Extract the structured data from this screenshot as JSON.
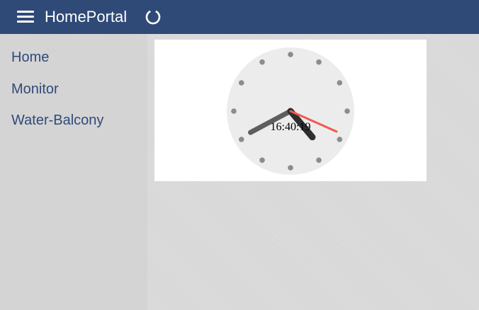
{
  "header": {
    "title": "HomePortal",
    "menu_icon": "hamburger-menu-icon",
    "refresh_icon": "refresh-icon",
    "background_color": "#304a78"
  },
  "sidebar": {
    "items": [
      {
        "label": "Home"
      },
      {
        "label": "Monitor"
      },
      {
        "label": "Water-Balcony"
      }
    ],
    "link_color": "#2f4a7a"
  },
  "clock": {
    "time_text": "16:40:19",
    "hours": 16,
    "minutes": 40,
    "seconds": 19,
    "face_color": "#ececec",
    "marker_color": "#8c8c8c",
    "hour_hand_color": "#2e2e2e",
    "minute_hand_color": "#5e5e5e",
    "second_hand_color": "#f05a50"
  }
}
